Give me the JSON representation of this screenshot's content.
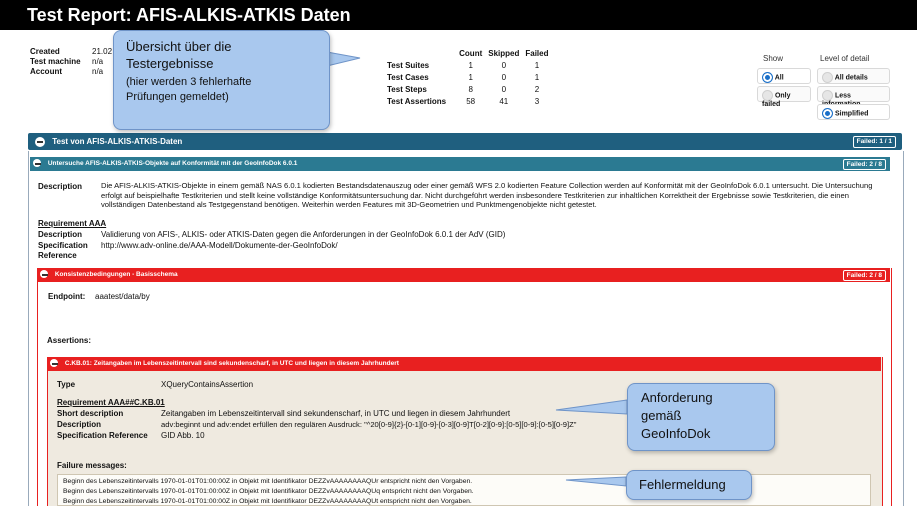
{
  "title": "Test Report: AFIS-ALKIS-ATKIS Daten",
  "meta": {
    "created_label": "Created",
    "created_value": "21.02",
    "machine_label": "Test machine",
    "machine_value": "n/a",
    "account_label": "Account",
    "account_value": "n/a"
  },
  "callouts": {
    "overview_line1": "Übersicht über die",
    "overview_line2": "Testergebnisse",
    "overview_line3": "(hier werden 3 fehlerhafte",
    "overview_line4": "Prüfungen gemeldet)",
    "requirement_line1": "Anforderung",
    "requirement_line2": "gemäß",
    "requirement_line3": "GeoInfoDok",
    "error_label": "Fehlermeldung"
  },
  "stats": {
    "headers": [
      "Count",
      "Skipped",
      "Failed"
    ],
    "rows": [
      {
        "label": "Test Suites",
        "count": "1",
        "skipped": "0",
        "failed": "1"
      },
      {
        "label": "Test Cases",
        "count": "1",
        "skipped": "0",
        "failed": "1"
      },
      {
        "label": "Test Steps",
        "count": "8",
        "skipped": "0",
        "failed": "2"
      },
      {
        "label": "Test Assertions",
        "count": "58",
        "skipped": "41",
        "failed": "3"
      }
    ]
  },
  "show": {
    "heading": "Show",
    "options": [
      "All",
      "Only failed"
    ],
    "selected": "All"
  },
  "detail": {
    "heading": "Level of detail",
    "options": [
      "All details",
      "Less information",
      "Simplified"
    ],
    "selected": "Simplified"
  },
  "suite": {
    "title": "Test von AFIS-ALKIS-ATKIS-Daten",
    "badge": "Failed: 1 / 1"
  },
  "testcase": {
    "title": "Untersuche AFIS-ALKIS-ATKIS-Objekte auf Konformität mit der GeoInfoDok 6.0.1",
    "badge": "Failed: 2 / 8",
    "description_label": "Description",
    "description_text": "Die AFIS-ALKIS-ATKIS-Objekte in einem gemäß NAS 6.0.1 kodierten Bestandsdatenauszug oder einer gemäß WFS 2.0 kodierten Feature Collection werden auf Konformität mit der GeoInfoDok 6.0.1 untersucht. Die Untersuchung erfolgt auf beispielhafte Testkriterien und stellt keine vollständige Konformitätsuntersuchung dar. Nicht durchgeführt werden insbesondere Testkriterien zur inhaltlichen Korrektheit der Ergebnisse sowie Testkriterien, die einen vollständigen Datenbestand als Testgegenstand benötigen. Weiterhin werden Features mit 3D-Geometrien und Punktmengenobjekte nicht getestet.",
    "requirement_heading": "Requirement AAA",
    "req_description_label": "Description",
    "req_description_text": "Validierung von AFIS-, ALKIS- oder ATKIS-Daten gegen die Anforderungen in der GeoInfoDok 6.0.1 der AdV (GID)",
    "spec_label": "Specification Reference",
    "spec_text": "http://www.adv-online.de/AAA-Modell/Dokumente-der-GeoInfoDok/"
  },
  "step": {
    "title": "Konsistenzbedingungen - Basisschema",
    "badge": "Failed: 2 / 8",
    "endpoint_label": "Endpoint:",
    "endpoint_value": "aaatest/data/by",
    "assertions_label": "Assertions:"
  },
  "assertion": {
    "title": "C.KB.01: Zeitangaben im Lebenszeitintervall sind sekundenscharf, in UTC und liegen in diesem Jahrhundert",
    "type_label": "Type",
    "type_value": "XQueryContainsAssertion",
    "requirement_heading": "Requirement AAA##C.KB.01",
    "short_label": "Short description",
    "short_value": "Zeitangaben im Lebenszeitintervall sind sekundenscharf, in UTC und liegen in diesem Jahrhundert",
    "desc_label": "Description",
    "desc_value": "adv:beginnt und adv:endet erfüllen den regulären Ausdruck: \"^20[0-9]{2}-[0-1][0-9]-[0-3][0-9]T[0-2][0-9]:[0-5][0-9]:[0-5][0-9]Z\"",
    "spec_label": "Specification Reference",
    "spec_value": "GID Abb. 10",
    "failure_heading": "Failure messages:",
    "messages": [
      "Beginn des Lebenszeitintervalls 1970-01-01T01:00:00Z in Objekt mit Identifikator DEZZvAAAAAAAAQUr entspricht nicht den Vorgaben.",
      "Beginn des Lebenszeitintervalls 1970-01-01T01:00:00Z in Objekt mit Identifikator DEZZvAAAAAAAAQUq entspricht nicht den Vorgaben.",
      "Beginn des Lebenszeitintervalls 1970-01-01T01:00:00Z in Objekt mit Identifikator DEZZvAAAAAAAAQUt entspricht nicht den Vorgaben."
    ]
  },
  "colors": {
    "suite_bar": "#1f5f7f",
    "testcase_bar": "#2b7a92",
    "failed_bar": "#e82020",
    "callout": "#a9c8ee",
    "assertion_panel": "#efeae0"
  }
}
